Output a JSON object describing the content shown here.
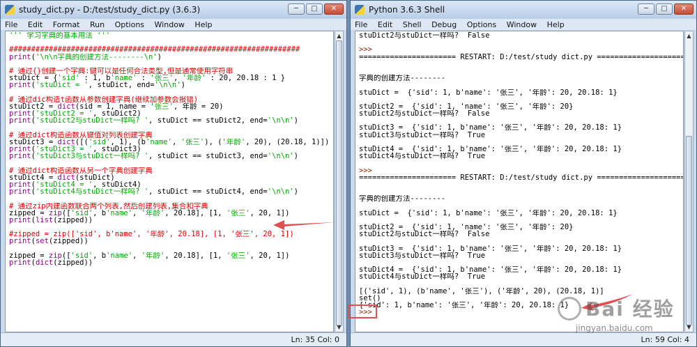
{
  "colors": {
    "comment": "#dd0000",
    "string": "#00aa00",
    "builtin": "#900090",
    "output": "#0000ff",
    "prompt": "#992200",
    "annotation": "#e05050"
  },
  "editor": {
    "title": "study_dict.py - D:/test/study_dict.py (3.6.3)",
    "menu": [
      "File",
      "Edit",
      "Format",
      "Run",
      "Options",
      "Window",
      "Help"
    ],
    "status": "Ln: 35   Col: 0",
    "lines": [
      [
        {
          "t": "''' 学习字典的基本用法 '''",
          "c": "string"
        }
      ],
      [
        {
          "t": "",
          "c": ""
        }
      ],
      [
        {
          "t": "##################################################################",
          "c": "comment"
        }
      ],
      [
        {
          "t": "print",
          "c": "builtin"
        },
        {
          "t": "(",
          "c": ""
        },
        {
          "t": "'\\n\\n字典的创建方法--------\\n'",
          "c": "string"
        },
        {
          "t": ")",
          "c": ""
        }
      ],
      [
        {
          "t": "",
          "c": ""
        }
      ],
      [
        {
          "t": "# 通过{}创建一个字典:键可以是任何合法类型,但是通常使用字符串",
          "c": "comment"
        }
      ],
      [
        {
          "t": "stuDict = {",
          "c": ""
        },
        {
          "t": "'sid'",
          "c": "string"
        },
        {
          "t": " : 1, b",
          "c": ""
        },
        {
          "t": "'name'",
          "c": "string"
        },
        {
          "t": " : ",
          "c": ""
        },
        {
          "t": "'张三'",
          "c": "string"
        },
        {
          "t": ", ",
          "c": ""
        },
        {
          "t": "'年龄'",
          "c": "string"
        },
        {
          "t": " : 20, 20.18 : 1 }",
          "c": ""
        }
      ],
      [
        {
          "t": "print",
          "c": "builtin"
        },
        {
          "t": "(",
          "c": ""
        },
        {
          "t": "'stuDict = '",
          "c": "string"
        },
        {
          "t": ", stuDict, end=",
          "c": ""
        },
        {
          "t": "'\\n\\n'",
          "c": "string"
        },
        {
          "t": ")",
          "c": ""
        }
      ],
      [
        {
          "t": "",
          "c": ""
        }
      ],
      [
        {
          "t": "# 通过dic构造t函数从参数创建字典(继续加参数会报错)",
          "c": "comment"
        }
      ],
      [
        {
          "t": "stuDict2 = ",
          "c": ""
        },
        {
          "t": "dict",
          "c": "builtin"
        },
        {
          "t": "(sid = 1, name = ",
          "c": ""
        },
        {
          "t": "'张三'",
          "c": "string"
        },
        {
          "t": ", 年龄 = 20)",
          "c": ""
        }
      ],
      [
        {
          "t": "print",
          "c": "builtin"
        },
        {
          "t": "(",
          "c": ""
        },
        {
          "t": "'stuDict2 = '",
          "c": "string"
        },
        {
          "t": ", stuDict2)",
          "c": ""
        }
      ],
      [
        {
          "t": "print",
          "c": "builtin"
        },
        {
          "t": "(",
          "c": ""
        },
        {
          "t": "'stuDict2与stuDict一样吗? '",
          "c": "string"
        },
        {
          "t": ", stuDict == stuDict2, end=",
          "c": ""
        },
        {
          "t": "'\\n\\n'",
          "c": "string"
        },
        {
          "t": ")",
          "c": ""
        }
      ],
      [
        {
          "t": "",
          "c": ""
        }
      ],
      [
        {
          "t": "# 通过dict构造函数从键值对列表创建字典",
          "c": "comment"
        }
      ],
      [
        {
          "t": "stuDict3 = ",
          "c": ""
        },
        {
          "t": "dict",
          "c": "builtin"
        },
        {
          "t": "([(",
          "c": ""
        },
        {
          "t": "'sid'",
          "c": "string"
        },
        {
          "t": ", 1), (b",
          "c": ""
        },
        {
          "t": "'name'",
          "c": "string"
        },
        {
          "t": ", ",
          "c": ""
        },
        {
          "t": "'张三'",
          "c": "string"
        },
        {
          "t": "), (",
          "c": ""
        },
        {
          "t": "'年龄'",
          "c": "string"
        },
        {
          "t": ", 20), (20.18, 1)])",
          "c": ""
        }
      ],
      [
        {
          "t": "print",
          "c": "builtin"
        },
        {
          "t": "(",
          "c": ""
        },
        {
          "t": "'stuDict3 = '",
          "c": "string"
        },
        {
          "t": ", stuDict3)",
          "c": ""
        }
      ],
      [
        {
          "t": "print",
          "c": "builtin"
        },
        {
          "t": "(",
          "c": ""
        },
        {
          "t": "'stuDict3与stuDict一样吗? '",
          "c": "string"
        },
        {
          "t": ", stuDict == stuDict3, end=",
          "c": ""
        },
        {
          "t": "'\\n\\n'",
          "c": "string"
        },
        {
          "t": ")",
          "c": ""
        }
      ],
      [
        {
          "t": "",
          "c": ""
        }
      ],
      [
        {
          "t": "# 通过dict构造函数从另一个字典创建字典",
          "c": "comment"
        }
      ],
      [
        {
          "t": "stuDict4 = ",
          "c": ""
        },
        {
          "t": "dict",
          "c": "builtin"
        },
        {
          "t": "(stuDict)",
          "c": ""
        }
      ],
      [
        {
          "t": "print",
          "c": "builtin"
        },
        {
          "t": "(",
          "c": ""
        },
        {
          "t": "'stuDict4 = '",
          "c": "string"
        },
        {
          "t": ", stuDict4)",
          "c": ""
        }
      ],
      [
        {
          "t": "print",
          "c": "builtin"
        },
        {
          "t": "(",
          "c": ""
        },
        {
          "t": "'stuDict4与stuDict一样吗? '",
          "c": "string"
        },
        {
          "t": ", stuDict == stuDict4, end=",
          "c": ""
        },
        {
          "t": "'\\n\\n'",
          "c": "string"
        },
        {
          "t": ")",
          "c": ""
        }
      ],
      [
        {
          "t": "",
          "c": ""
        }
      ],
      [
        {
          "t": "# 通过zip内建函数联合两个列表,然后创建列表,集合和字典",
          "c": "comment"
        }
      ],
      [
        {
          "t": "zipped = ",
          "c": ""
        },
        {
          "t": "zip",
          "c": "builtin"
        },
        {
          "t": "([",
          "c": ""
        },
        {
          "t": "'sid'",
          "c": "string"
        },
        {
          "t": ", b",
          "c": ""
        },
        {
          "t": "'name'",
          "c": "string"
        },
        {
          "t": ", ",
          "c": ""
        },
        {
          "t": "'年龄'",
          "c": "string"
        },
        {
          "t": ", 20.18], [1, ",
          "c": ""
        },
        {
          "t": "'张三'",
          "c": "string"
        },
        {
          "t": ", 20, 1])",
          "c": ""
        }
      ],
      [
        {
          "t": "print",
          "c": "builtin"
        },
        {
          "t": "(",
          "c": ""
        },
        {
          "t": "list",
          "c": "builtin"
        },
        {
          "t": "(zipped))",
          "c": ""
        }
      ],
      [
        {
          "t": "",
          "c": ""
        }
      ],
      [
        {
          "t": "#zipped = zip(['sid', b'name', '年龄', 20.18], [1, '张三', 20, 1])",
          "c": "comment"
        }
      ],
      [
        {
          "t": "print",
          "c": "builtin"
        },
        {
          "t": "(",
          "c": ""
        },
        {
          "t": "set",
          "c": "builtin"
        },
        {
          "t": "(zipped))",
          "c": ""
        }
      ],
      [
        {
          "t": "",
          "c": ""
        }
      ],
      [
        {
          "t": "zipped = ",
          "c": ""
        },
        {
          "t": "zip",
          "c": "builtin"
        },
        {
          "t": "([",
          "c": ""
        },
        {
          "t": "'sid'",
          "c": "string"
        },
        {
          "t": ", b",
          "c": ""
        },
        {
          "t": "'name'",
          "c": "string"
        },
        {
          "t": ", ",
          "c": ""
        },
        {
          "t": "'年龄'",
          "c": "string"
        },
        {
          "t": ", 20.18], [1, ",
          "c": ""
        },
        {
          "t": "'张三'",
          "c": "string"
        },
        {
          "t": ", 20, 1])",
          "c": ""
        }
      ],
      [
        {
          "t": "print",
          "c": "builtin"
        },
        {
          "t": "(",
          "c": ""
        },
        {
          "t": "dict",
          "c": "builtin"
        },
        {
          "t": "(zipped))",
          "c": ""
        }
      ]
    ]
  },
  "shell": {
    "title": "Python 3.6.3 Shell",
    "menu": [
      "File",
      "Edit",
      "Shell",
      "Debug",
      "Options",
      "Window",
      "Help"
    ],
    "status": "Ln: 59   Col: 4",
    "lines": [
      [
        {
          "t": "stuDict2与stuDict一样吗?  False",
          "c": "output"
        }
      ],
      [
        {
          "t": "",
          "c": ""
        }
      ],
      [
        {
          "t": ">>> ",
          "c": "prompt"
        }
      ],
      [
        {
          "t": "====================== RESTART: D:/test/study_dict.py ======================",
          "c": "restart"
        }
      ],
      [
        {
          "t": "",
          "c": ""
        }
      ],
      [
        {
          "t": "",
          "c": ""
        }
      ],
      [
        {
          "t": "字典的创建方法--------",
          "c": "output"
        }
      ],
      [
        {
          "t": "",
          "c": ""
        }
      ],
      [
        {
          "t": "stuDict =  {'sid': 1, b'name': '张三', '年龄': 20, 20.18: 1}",
          "c": "output"
        }
      ],
      [
        {
          "t": "",
          "c": ""
        }
      ],
      [
        {
          "t": "stuDict2 =  {'sid': 1, 'name': '张三', '年龄': 20}",
          "c": "output"
        }
      ],
      [
        {
          "t": "stuDict2与stuDict一样吗?  False",
          "c": "output"
        }
      ],
      [
        {
          "t": "",
          "c": ""
        }
      ],
      [
        {
          "t": "stuDict3 =  {'sid': 1, b'name': '张三', '年龄': 20, 20.18: 1}",
          "c": "output"
        }
      ],
      [
        {
          "t": "stuDict3与stuDict一样吗?  True",
          "c": "output"
        }
      ],
      [
        {
          "t": "",
          "c": ""
        }
      ],
      [
        {
          "t": "stuDict4 =  {'sid': 1, b'name': '张三', '年龄': 20, 20.18: 1}",
          "c": "output"
        }
      ],
      [
        {
          "t": "stuDict4与stuDict一样吗?  True",
          "c": "output"
        }
      ],
      [
        {
          "t": "",
          "c": ""
        }
      ],
      [
        {
          "t": ">>> ",
          "c": "prompt"
        }
      ],
      [
        {
          "t": "====================== RESTART: D:/test/study_dict.py ======================",
          "c": "restart"
        }
      ],
      [
        {
          "t": "",
          "c": ""
        }
      ],
      [
        {
          "t": "",
          "c": ""
        }
      ],
      [
        {
          "t": "字典的创建方法--------",
          "c": "output"
        }
      ],
      [
        {
          "t": "",
          "c": ""
        }
      ],
      [
        {
          "t": "stuDict =  {'sid': 1, b'name': '张三', '年龄': 20, 20.18: 1}",
          "c": "output"
        }
      ],
      [
        {
          "t": "",
          "c": ""
        }
      ],
      [
        {
          "t": "stuDict2 =  {'sid': 1, 'name': '张三', '年龄': 20}",
          "c": "output"
        }
      ],
      [
        {
          "t": "stuDict2与stuDict一样吗?  False",
          "c": "output"
        }
      ],
      [
        {
          "t": "",
          "c": ""
        }
      ],
      [
        {
          "t": "stuDict3 =  {'sid': 1, b'name': '张三', '年龄': 20, 20.18: 1}",
          "c": "output"
        }
      ],
      [
        {
          "t": "stuDict3与stuDict一样吗?  True",
          "c": "output"
        }
      ],
      [
        {
          "t": "",
          "c": ""
        }
      ],
      [
        {
          "t": "stuDict4 =  {'sid': 1, b'name': '张三', '年龄': 20, 20.18: 1}",
          "c": "output"
        }
      ],
      [
        {
          "t": "stuDict4与stuDict一样吗?  True",
          "c": "output"
        }
      ],
      [
        {
          "t": "",
          "c": ""
        }
      ],
      [
        {
          "t": "[('sid', 1), (b'name', '张三'), ('年龄', 20), (20.18, 1)]",
          "c": "output"
        }
      ],
      [
        {
          "t": "set()",
          "c": "output"
        }
      ],
      [
        {
          "t": "{'sid': 1, b'name': '张三', '年龄': 20, 20.18: 1}",
          "c": "output"
        }
      ],
      [
        {
          "t": ">>> ",
          "c": "prompt"
        }
      ]
    ]
  },
  "watermark": {
    "main": "Bai 经验",
    "sub": "jingyan.baidu.com"
  }
}
